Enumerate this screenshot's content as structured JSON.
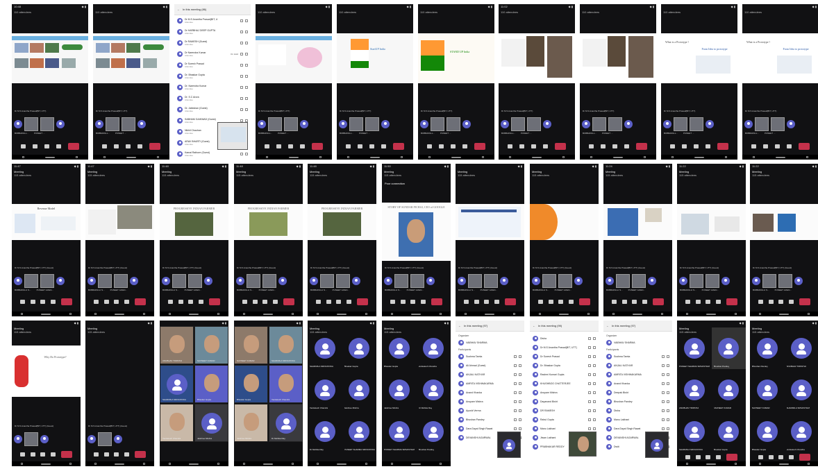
{
  "collage": {
    "row1": {
      "times": [
        "10:48",
        "",
        "",
        "",
        "",
        "",
        "11:02",
        "",
        "",
        ""
      ],
      "attendee_count": "110 attendees",
      "presenter_caption": "Dr M.S Anantha Prasad(BIT, UTT)",
      "bottom_names": [
        "BOBBAPALL...",
        "PUNEET ..."
      ],
      "participants_list": {
        "title": "In this meeting (86)",
        "rows": [
          {
            "name": "Dr M.S Anantha Prasad(BIT, U",
            "role": "Attendee"
          },
          {
            "name": "Dr HARBHAJ DEEP GUPTA",
            "role": "Attendee"
          },
          {
            "name": "Dr RAMESH (Guest)",
            "role": "Attendee"
          },
          {
            "name": "Dr Narendra Kumar",
            "role": "Attendee",
            "tag": "On Hold"
          },
          {
            "name": "Dr Suresh Prasad",
            "role": "Attendee"
          },
          {
            "name": "Dr. Bhaskar Gupta",
            "role": "Attendee"
          },
          {
            "name": "Dr. Narendra Kumar",
            "role": "Attendee"
          },
          {
            "name": "Dr. S.C Arora",
            "role": "Attendee"
          },
          {
            "name": "Dr. Jaikishan (Guest)",
            "role": "Attendee"
          },
          {
            "name": "SABHAM GAIKWAD (Guest)",
            "role": "Attendee"
          },
          {
            "name": "Nikhil Chauhan",
            "role": "Attendee"
          },
          {
            "name": "ARAV BHARTI (Guest)",
            "role": "Attendee"
          },
          {
            "name": "Kamal Rathore (Guest)",
            "role": "Attendee"
          }
        ]
      },
      "slides": {
        "startup_title": "StartUP India",
        "stand_up_title": "STAND UP India",
        "prototype_title": "What is a Prototype ?",
        "idea_title": "From Idea to prototype"
      }
    },
    "row2": {
      "times": [
        "11:47",
        "11:47",
        "11:48",
        "11:48",
        "11:48",
        "11:50",
        "",
        "",
        "11:24",
        "11:22"
      ],
      "meeting_label": "Meeting",
      "attendee_count": "115 attendees",
      "presenter_caption": "Dr M.S Anantha Prasad(BIT, UTT) (Guest)",
      "slides": {
        "revenue_title": "Revenue Model",
        "farmer_title": "PROGRESSIVE INDIAN FARMER",
        "ceo_title": "STORY OF SUNDAR PICHAI, CEO of GOOGLE",
        "poor_connection": "Poor connection"
      },
      "bottom_names": [
        "BOBBAPALLI S...",
        "PUNEET GOEN..."
      ]
    },
    "row3": {
      "meeting_label": "Meeting",
      "attendee_count": "115 attendees",
      "slide_title": "Why Do Prototype?",
      "presenter_caption": "Dr M.S Anantha Prasad(BIT, UTT) (Guest)",
      "grid_names": [
        "PUNEET SHARMA SRIVASTAVA",
        "Bhushan Pandey",
        "ANUBHAV TRIPATHI",
        "NAVNEET KUMAR",
        "SHARMILA SRIVASTAVA",
        "Bhaskar Gupta",
        "Venkatesh Chandra",
        "Jaishree Mishra",
        "Dr.Nishika Ray"
      ],
      "organizer_list": {
        "title": "In this meeting (97)",
        "organizer_label": "Organizer",
        "participants_label": "Participants",
        "organizer": "VAIBHAV SHARMA",
        "rows": [
          "Sushma Tamta",
          "Ali Ahmad (Guest)",
          "ANJALI KATIYAR",
          "AMRITA VISHWAKARMA",
          "Anand Khanka",
          "Anupam Mishra",
          "Ayushi Verma",
          "Bhushan Pandey",
          "Dara Dayal Singh Rawat",
          "DEVANSHI AGARWAL"
        ]
      },
      "second_list": {
        "title": "In this meeting (99)",
        "rows": [
          "Disha",
          "Dr M.S Anantha Prasad(BIT, UTT)",
          "Dr Suresh Prasad",
          "Dr. Bhaskar Gupta",
          "Rashmi Kumari Gupta",
          "KHUSHBOO CHATTERJEE",
          "Anupam Mishra",
          "Dayanand Bisht",
          "DR RAMESH",
          "Rahul Gupta",
          "Manu Lakhani",
          "Jiwan Lakhani",
          "PRABHAKAR REDDY"
        ]
      },
      "third_list": {
        "title": "In this meeting (97)",
        "organizer": "VAIBHAV SHARMA",
        "rows": [
          "Sushma Tamta",
          "ANJALI KATIYAR",
          "AMRITA VISHWAKARMA",
          "Anand Khanka",
          "Deepak Bisht",
          "Bhushan Pandey",
          "Disha",
          "Manu Lakhani",
          "Dara Dayal Singh Rawat",
          "DEVANSHI AGARWAL",
          "Dwiti"
        ]
      }
    },
    "colors": {
      "tile_background": "#111113",
      "teams_avatar": "#5b5fc7",
      "hangup_red": "#c4314b",
      "list_header_blue": "#2b4f9c"
    },
    "icons": [
      "camera-icon",
      "mic-icon",
      "speaker-icon",
      "more-icon",
      "hangup-icon",
      "back-icon",
      "share-icon"
    ]
  }
}
